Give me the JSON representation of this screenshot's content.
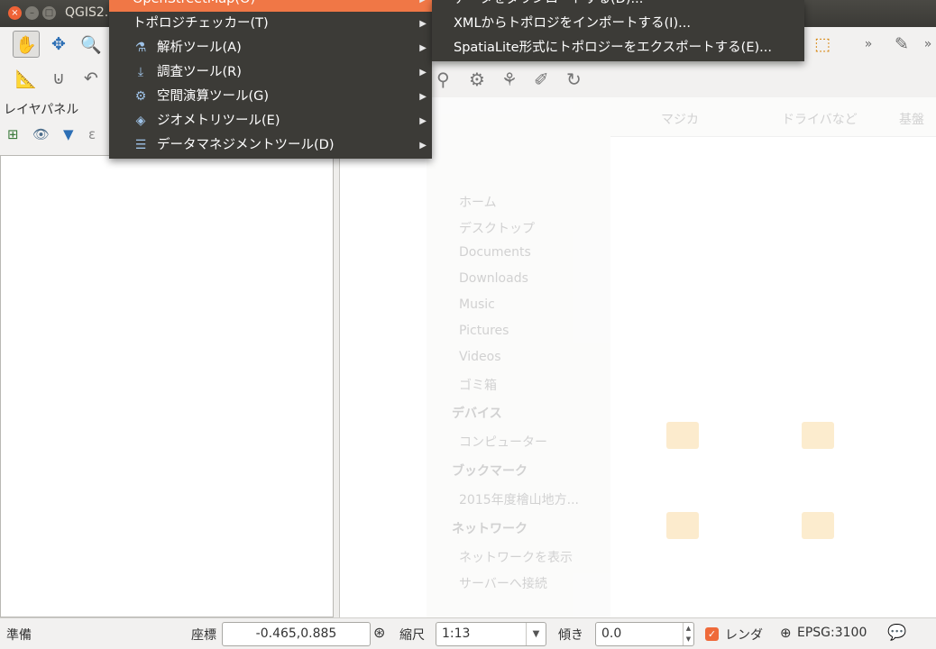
{
  "window": {
    "title": "QGIS2.",
    "close_glyph": "×",
    "min_glyph": "–",
    "max_glyph": "□"
  },
  "main_menu": {
    "items": [
      {
        "label": "OpenStreetMap(O)",
        "icon": "",
        "has_submenu": true,
        "highlighted": true
      },
      {
        "label": "トポロジチェッカー(T)",
        "icon": "",
        "has_submenu": true
      },
      {
        "label": "解析ツール(A)",
        "icon": "analysis-icon",
        "has_submenu": true
      },
      {
        "label": "調査ツール(R)",
        "icon": "research-icon",
        "has_submenu": true
      },
      {
        "label": "空間演算ツール(G)",
        "icon": "geoprocessing-icon",
        "has_submenu": true
      },
      {
        "label": "ジオメトリツール(E)",
        "icon": "geometry-icon",
        "has_submenu": true
      },
      {
        "label": "データマネジメントツール(D)",
        "icon": "data-management-icon",
        "has_submenu": true
      }
    ],
    "arrow": "▶"
  },
  "sub_menu": {
    "items": [
      {
        "label": "データをダウンロードする(D)..."
      },
      {
        "label": "XMLからトポロジをインポートする(I)..."
      },
      {
        "label": "SpatiaLite形式にトポロジーをエクスポートする(E)..."
      }
    ]
  },
  "layer_panel": {
    "title": "レイヤパネル"
  },
  "background_window": {
    "headers": [
      "マジカ",
      "ドライバなど",
      "基盤"
    ],
    "places": [
      "ホーム",
      "デスクトップ",
      "Documents",
      "Downloads",
      "Music",
      "Pictures",
      "Videos",
      "ゴミ箱"
    ],
    "sections": [
      "デバイス",
      "ブックマーク",
      "ネットワーク"
    ],
    "device_items": [
      "コンピューター"
    ],
    "bookmark_items": [
      "2015年度檜山地方..."
    ],
    "network_items": [
      "ネットワークを表示",
      "サーバーへ接続"
    ]
  },
  "status_bar": {
    "status_text": "準備",
    "coord_label": "座標",
    "coord_value": "-0.465,0.885",
    "scale_label": "縮尺",
    "scale_value": "1:13",
    "rotation_label": "傾き",
    "rotation_value": "0.0",
    "render_label": "レンダ",
    "render_checked": true,
    "crs_label": "EPSG:3100"
  },
  "colors": {
    "menu_bg": "#3c3b37",
    "menu_highlight": "#f07746",
    "titlebar": "#3b3a36",
    "window_bg": "#f2f1f0"
  }
}
